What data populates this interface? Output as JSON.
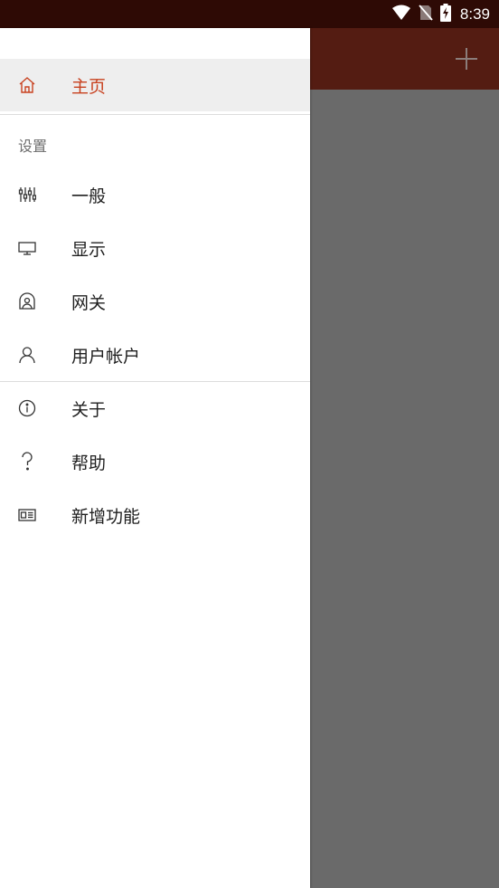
{
  "status_bar": {
    "time": "8:39",
    "icons": [
      "wifi-icon",
      "no-sim-icon",
      "battery-charging-icon"
    ]
  },
  "app_bar": {
    "add_icon": "plus-icon",
    "color": "#541c12"
  },
  "drawer": {
    "home": {
      "label": "主页",
      "icon": "home-icon",
      "selected": true,
      "accent": "#c8411f"
    },
    "settings_header": "设置",
    "settings_items": [
      {
        "label": "一般",
        "icon": "sliders-icon"
      },
      {
        "label": "显示",
        "icon": "monitor-icon"
      },
      {
        "label": "网关",
        "icon": "gateway-icon"
      },
      {
        "label": "用户帐户",
        "icon": "user-icon"
      }
    ],
    "other_items": [
      {
        "label": "关于",
        "icon": "info-icon"
      },
      {
        "label": "帮助",
        "icon": "help-icon"
      },
      {
        "label": "新增功能",
        "icon": "news-icon"
      }
    ]
  }
}
